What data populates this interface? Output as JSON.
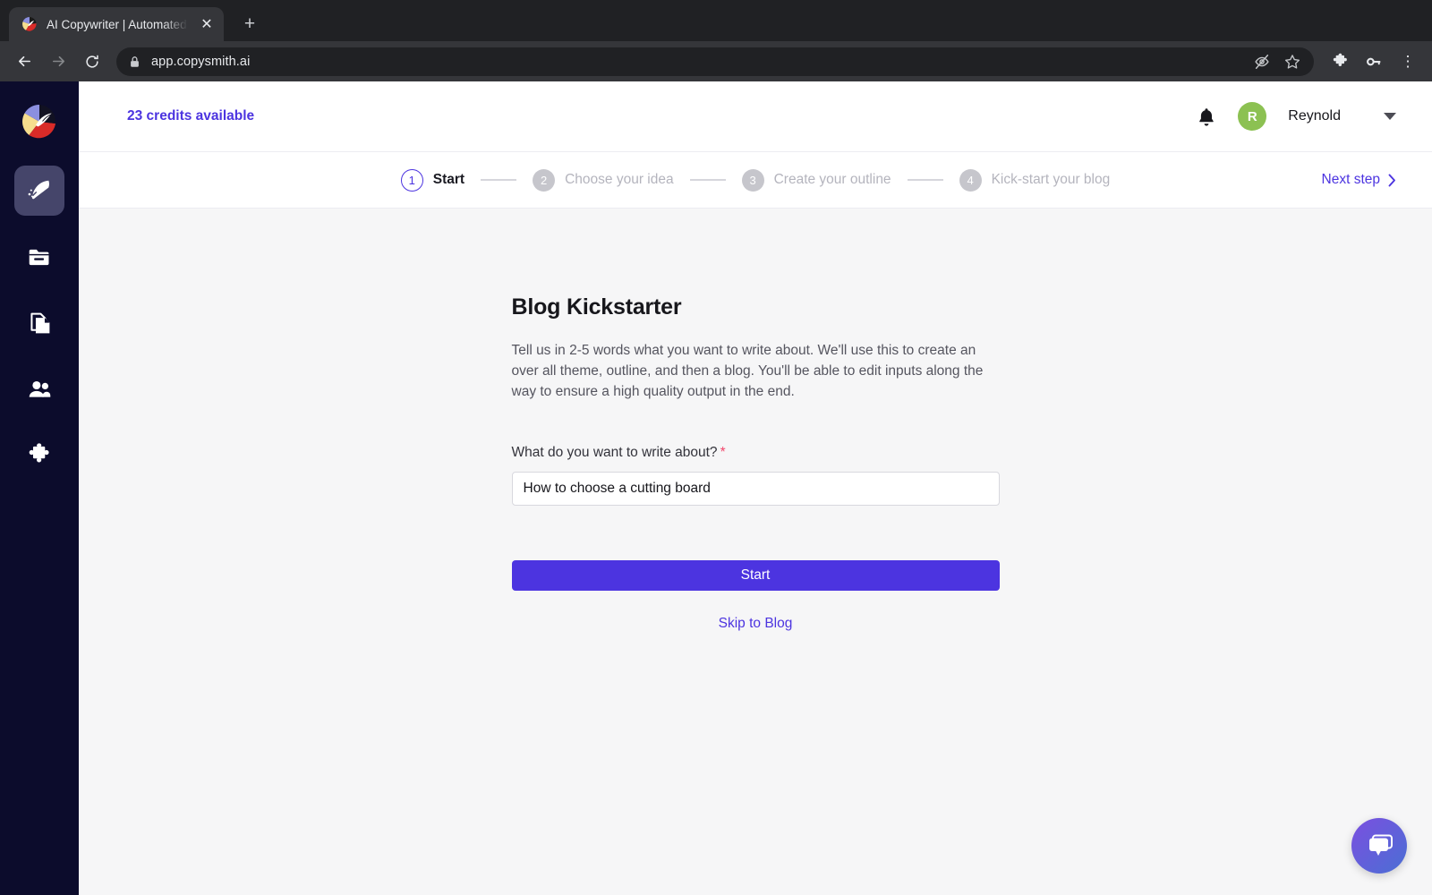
{
  "browser": {
    "tab": {
      "title": "AI Copywriter | Automated Con",
      "close_label": "✕",
      "favicon_name": "copysmith-favicon"
    },
    "new_tab_label": "+",
    "nav": {
      "back_label": "←",
      "forward_label": "→",
      "reload_label": "⟳"
    },
    "omnibox": {
      "url": "app.copysmith.ai",
      "lock_name": "site-lock-icon"
    },
    "actions": {
      "hide_password_label": "hide-password-icon",
      "bookmark_label": "bookmark-star-icon",
      "extensions_label": "extensions-puzzle-icon",
      "passwords_label": "passwords-key-icon",
      "menu_label": "⋮"
    }
  },
  "sidebar": {
    "brand_name": "copysmith-logo",
    "items": [
      {
        "name": "sidebar-item-create",
        "icon": "feather-icon",
        "active": true
      },
      {
        "name": "sidebar-item-files",
        "icon": "folder-icon",
        "active": false
      },
      {
        "name": "sidebar-item-documents",
        "icon": "copy-documents-icon",
        "active": false
      },
      {
        "name": "sidebar-item-team",
        "icon": "people-icon",
        "active": false
      },
      {
        "name": "sidebar-item-integrations",
        "icon": "puzzle-icon",
        "active": false
      }
    ]
  },
  "topbar": {
    "credits": "23 credits available",
    "notifications_name": "bell-icon",
    "avatar_initial": "R",
    "username": "Reynold",
    "dropdown_name": "chevron-down-icon"
  },
  "stepper": {
    "steps": [
      {
        "num": "1",
        "label": "Start",
        "current": true
      },
      {
        "num": "2",
        "label": "Choose your idea",
        "current": false
      },
      {
        "num": "3",
        "label": "Create your outline",
        "current": false
      },
      {
        "num": "4",
        "label": "Kick-start your blog",
        "current": false
      }
    ],
    "next_step_label": "Next step",
    "next_step_chevron": "›"
  },
  "main": {
    "title": "Blog Kickstarter",
    "description": "Tell us in 2-5 words what you want to write about. We'll use this to create an over all theme, outline, and then a blog. You'll be able to edit inputs along the way to ensure a high quality output in the end.",
    "field_label": "What do you want to write about?",
    "field_required_marker": "*",
    "field_value": "How to choose a cutting board",
    "field_placeholder": "",
    "start_button_label": "Start",
    "skip_link_label": "Skip to Blog"
  },
  "chat": {
    "fab_name": "chat-bubbles-icon"
  },
  "colors": {
    "accent": "#4c34e0",
    "sidebar_bg": "#0c0c2c",
    "sidebar_active": "#45456a",
    "page_bg": "#f6f6f7",
    "avatar_green": "#8cc152",
    "required_red": "#f2466b"
  }
}
